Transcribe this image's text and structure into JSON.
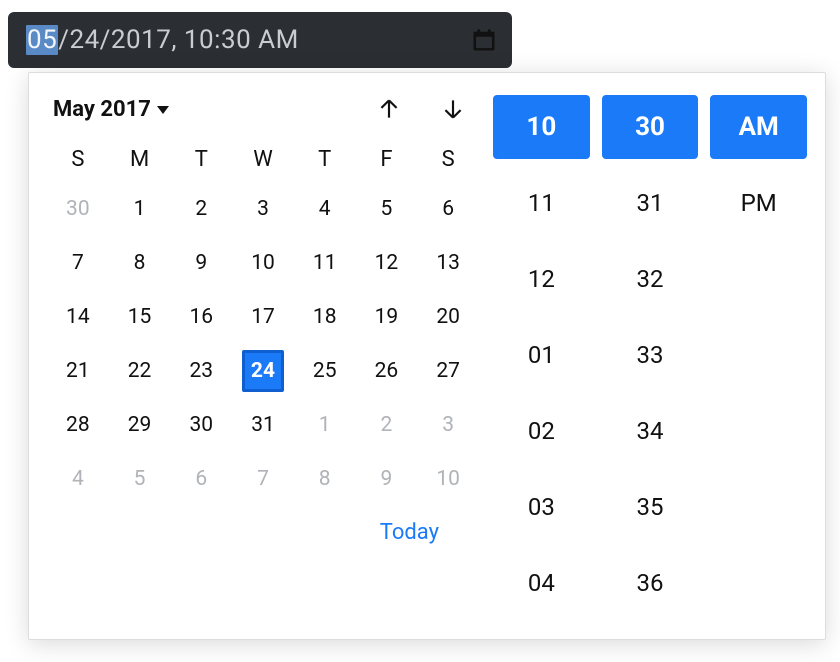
{
  "input": {
    "selected_segment": "05",
    "rest": "/24/2017, 10:30 AM"
  },
  "calendar": {
    "month_label": "May 2017",
    "up_label": "Previous month",
    "down_label": "Next month",
    "dow": [
      "S",
      "M",
      "T",
      "W",
      "T",
      "F",
      "S"
    ],
    "weeks": [
      [
        {
          "n": "30",
          "outside": true
        },
        {
          "n": "1"
        },
        {
          "n": "2"
        },
        {
          "n": "3"
        },
        {
          "n": "4"
        },
        {
          "n": "5"
        },
        {
          "n": "6"
        }
      ],
      [
        {
          "n": "7"
        },
        {
          "n": "8"
        },
        {
          "n": "9"
        },
        {
          "n": "10"
        },
        {
          "n": "11"
        },
        {
          "n": "12"
        },
        {
          "n": "13"
        }
      ],
      [
        {
          "n": "14"
        },
        {
          "n": "15"
        },
        {
          "n": "16"
        },
        {
          "n": "17"
        },
        {
          "n": "18"
        },
        {
          "n": "19"
        },
        {
          "n": "20"
        }
      ],
      [
        {
          "n": "21"
        },
        {
          "n": "22"
        },
        {
          "n": "23"
        },
        {
          "n": "24",
          "selected": true
        },
        {
          "n": "25"
        },
        {
          "n": "26"
        },
        {
          "n": "27"
        }
      ],
      [
        {
          "n": "28"
        },
        {
          "n": "29"
        },
        {
          "n": "30"
        },
        {
          "n": "31"
        },
        {
          "n": "1",
          "outside": true
        },
        {
          "n": "2",
          "outside": true
        },
        {
          "n": "3",
          "outside": true
        }
      ],
      [
        {
          "n": "4",
          "outside": true
        },
        {
          "n": "5",
          "outside": true
        },
        {
          "n": "6",
          "outside": true
        },
        {
          "n": "7",
          "outside": true
        },
        {
          "n": "8",
          "outside": true
        },
        {
          "n": "9",
          "outside": true
        },
        {
          "n": "10",
          "outside": true
        }
      ]
    ],
    "today_label": "Today"
  },
  "time": {
    "hours": [
      {
        "v": "10",
        "selected": true
      },
      {
        "v": "11"
      },
      {
        "v": "12"
      },
      {
        "v": "01"
      },
      {
        "v": "02"
      },
      {
        "v": "03"
      },
      {
        "v": "04"
      }
    ],
    "minutes": [
      {
        "v": "30",
        "selected": true
      },
      {
        "v": "31"
      },
      {
        "v": "32"
      },
      {
        "v": "33"
      },
      {
        "v": "34"
      },
      {
        "v": "35"
      },
      {
        "v": "36"
      }
    ],
    "ampm": [
      {
        "v": "AM",
        "selected": true
      },
      {
        "v": "PM"
      }
    ]
  },
  "colors": {
    "accent": "#1a7af8",
    "accent_border": "#0f5fd0",
    "input_bg": "#2b2f33",
    "muted": "#b0b3b7"
  }
}
